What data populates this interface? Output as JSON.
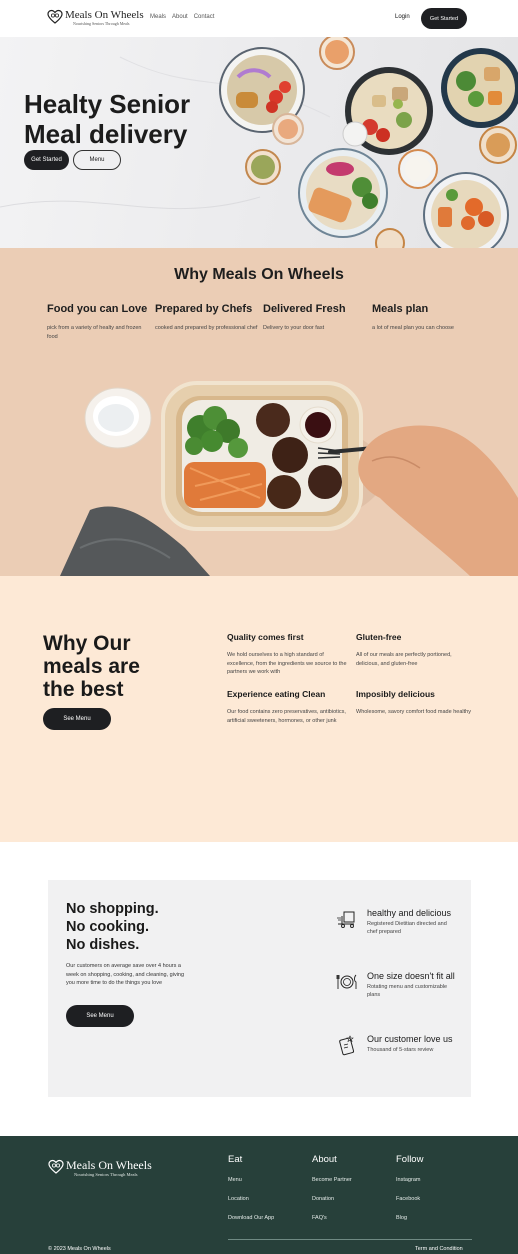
{
  "brand": {
    "name": "Meals On Wheels",
    "tagline": "Nourishing Seniors Through Meals"
  },
  "nav": {
    "links": [
      "Meals",
      "About",
      "Contact"
    ],
    "login": "Login",
    "cta": "Get Started"
  },
  "hero": {
    "title_line1": "Healty Senior",
    "title_line2": "Meal delivery",
    "primary_btn": "Get Started",
    "secondary_btn": "Menu"
  },
  "why": {
    "title": "Why Meals On Wheels",
    "features": [
      {
        "title": "Food you can Love",
        "text": "pick from a variety of healty and frozen food"
      },
      {
        "title": "Prepared by Chefs",
        "text": "cooked and prepared by professional chef"
      },
      {
        "title": "Delivered Fresh",
        "text": "Delivery to your door fast"
      },
      {
        "title": "Meals plan",
        "text": "a lot of meal plan you can choose"
      }
    ]
  },
  "best": {
    "title_line1": "Why Our",
    "title_line2": "meals are",
    "title_line3": "the best",
    "button": "See Menu",
    "features": [
      {
        "title": "Quality comes first",
        "text": "We hold ourselves to a high standard of excellence, from the ingredients we source to the partners we work with"
      },
      {
        "title": "Gluten-free",
        "text": "All of our meals are perfectly portioned, delicious, and gluten-free"
      },
      {
        "title": "Experience eating Clean",
        "text": "Our food contains zero preservatives, antibiotics, artificial sweeteners, hormones, or other junk"
      },
      {
        "title": "Imposibly delicious",
        "text": "Wholesome, savory comfort food made healthy"
      }
    ]
  },
  "noshop": {
    "title_line1": "No shopping.",
    "title_line2": "No cooking.",
    "title_line3": "No dishes.",
    "text": "Our customers on average save over 4 hours a week on shopping, cooking, and cleaning, giving you more time to do the things you love",
    "button": "See Menu",
    "features": [
      {
        "icon": "delivery-cart-icon",
        "title": "healthy and delicious",
        "text": "Registered Dietitian directed and chef prepared"
      },
      {
        "icon": "plate-cutlery-icon",
        "title": "One size doesn't fit all",
        "text": "Rotating menu and customizable plans"
      },
      {
        "icon": "review-phone-icon",
        "title": "Our customer love us",
        "text": "Thousand of 5-stars review"
      }
    ]
  },
  "footer": {
    "columns": [
      {
        "title": "Eat",
        "items": [
          "Menu",
          "Location",
          "Download Our App"
        ]
      },
      {
        "title": "About",
        "items": [
          "Become Partner",
          "Donation",
          "FAQ's"
        ]
      },
      {
        "title": "Follow",
        "items": [
          "Instagram",
          "Facebook",
          "Blog"
        ]
      }
    ],
    "copyright": "© 2023 Meals On Wheels",
    "terms": "Term and Condition"
  },
  "colors": {
    "dark_button": "#1e1f22",
    "peach_section": "#ebcdb5",
    "cream_section": "#fde9d6",
    "footer_green": "#27403a"
  }
}
